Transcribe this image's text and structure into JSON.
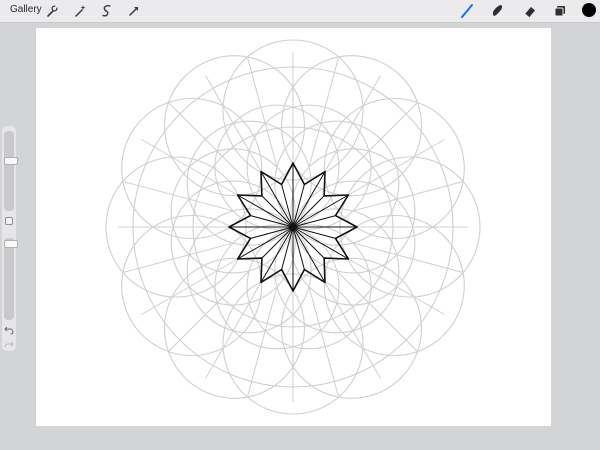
{
  "toolbar": {
    "gallery_label": "Gallery",
    "left_tools": [
      "wrench-icon",
      "magic-wand-icon",
      "selection-icon",
      "transform-arrow-icon"
    ],
    "right_tools": [
      "brush-icon",
      "smudge-icon",
      "eraser-icon",
      "layers-icon"
    ],
    "active_tool": "brush-icon",
    "accent_color": "#1e6ff0",
    "current_color": "#000000"
  },
  "sidebar": {
    "brush_size_level": 0.22,
    "opacity_level": 0.03,
    "controls": [
      "modify-square-icon",
      "undo-icon",
      "redo-icon"
    ]
  },
  "canvas": {
    "background": "#ffffff",
    "guide_color": "#cfcfcf",
    "ink_color": "#111111",
    "drawing": "rosette-of-overlapping-circles-with-12-point-star-center"
  }
}
